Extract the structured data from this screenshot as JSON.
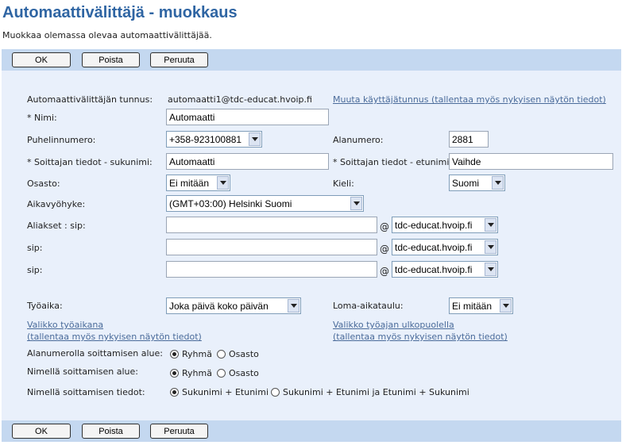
{
  "page": {
    "title": "Automaattivälittäjä - muokkaus",
    "subtitle": "Muokkaa olemassa olevaa automaattivälittäjää."
  },
  "toolbar": {
    "ok_label": "OK",
    "delete_label": "Poista",
    "cancel_label": "Peruuta"
  },
  "form": {
    "id_label": "Automaattivälittäjän tunnus:",
    "id_value": "automaatti1@tdc-educat.hvoip.fi",
    "change_user_link": "Muuta käyttäjätunnus (tallentaa myös nykyisen näytön tiedot)",
    "name_label": "* Nimi:",
    "name_value": "Automaatti",
    "phone_label": "Puhelinnumero:",
    "phone_value": "+358-923100881",
    "extension_label": "Alanumero:",
    "extension_value": "2881",
    "caller_lastname_label": "* Soittajan tiedot - sukunimi:",
    "caller_lastname_value": "Automaatti",
    "caller_firstname_label": "* Soittajan tiedot - etunimi:",
    "caller_firstname_value": "Vaihde",
    "department_label": "Osasto:",
    "department_value": "Ei mitään",
    "language_label": "Kieli:",
    "language_value": "Suomi",
    "timezone_label": "Aikavyöhyke:",
    "timezone_value": "(GMT+03:00) Helsinki Suomi",
    "aliases_label": "Aliakset : sip:",
    "sip_label_2": "sip:",
    "sip_label_3": "sip:",
    "at_sign": "@",
    "alias_1_value": "",
    "alias_2_value": "",
    "alias_3_value": "",
    "domain_1": "tdc-educat.hvoip.fi",
    "domain_2": "tdc-educat.hvoip.fi",
    "domain_3": "tdc-educat.hvoip.fi",
    "worktime_label": "Työaika:",
    "worktime_value": "Joka päivä koko päivän",
    "holiday_label": "Loma-aikataulu:",
    "holiday_value": "Ei mitään",
    "worktime_menu_link_1": "Valikko työaikana",
    "worktime_menu_link_2": "(tallentaa myös nykyisen näytön tiedot)",
    "offhours_menu_link_1": "Valikko työajan ulkopuolella",
    "offhours_menu_link_2": "(tallentaa myös nykyisen näytön tiedot)",
    "ext_dial_scope_label": "Alanumerolla soittamisen alue:",
    "name_dial_scope_label": "Nimellä soittamisen alue:",
    "name_dial_info_label": "Nimellä soittamisen tiedot:",
    "opt_group": "Ryhmä",
    "opt_department": "Osasto",
    "opt_last_first": "Sukunimi + Etunimi",
    "opt_both": "Sukunimi + Etunimi ja Etunimi + Sukunimi"
  },
  "selected": {
    "ext_dial_scope": "Ryhmä",
    "name_dial_scope": "Ryhmä",
    "name_dial_info": "Sukunimi + Etunimi"
  },
  "colors": {
    "title": "#2f65a3",
    "toolbar_bg": "#c4d8f0",
    "panel_bg": "#e9f0fb",
    "link": "#4a6b9a"
  }
}
